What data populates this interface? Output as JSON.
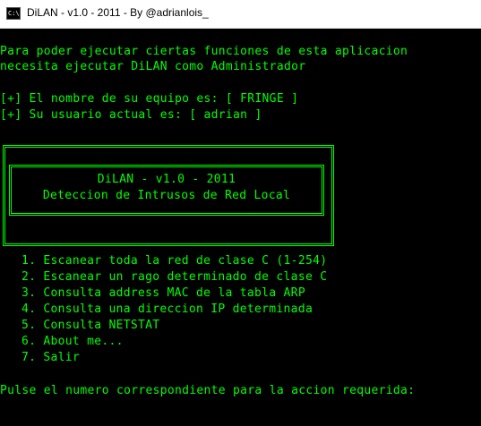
{
  "window": {
    "title": "DiLAN - v1.0 - 2011 - By @adrianlois_",
    "icon": "console-icon",
    "icon_text": "C:\\"
  },
  "colors": {
    "text": "#00ff00",
    "background": "#000000",
    "titlebar": "#ffffff"
  },
  "console": {
    "admin_notice": [
      "Para poder ejecutar ciertas funciones de esta aplicacion",
      "necesita ejecutar DiLAN como Administrador"
    ],
    "host_line": "[+] El nombre de su equipo es: [ FRINGE ]",
    "user_line": "[+] Su usuario actual es: [ adrian ]",
    "banner": {
      "title": "DiLAN - v1.0 - 2011",
      "subtitle": "Deteccion de Intrusos de Red Local"
    },
    "menu": [
      "1. Escanear toda la red de clase C (1-254)",
      "2. Escanear un rago determinado de clase C",
      "3. Consulta address MAC de la tabla ARP",
      "4. Consulta una direccion IP determinada",
      "5. Consulta NETSTAT",
      "6. About me...",
      "7. Salir"
    ],
    "prompt": "Pulse el numero correspondiente para la accion requerida:"
  }
}
